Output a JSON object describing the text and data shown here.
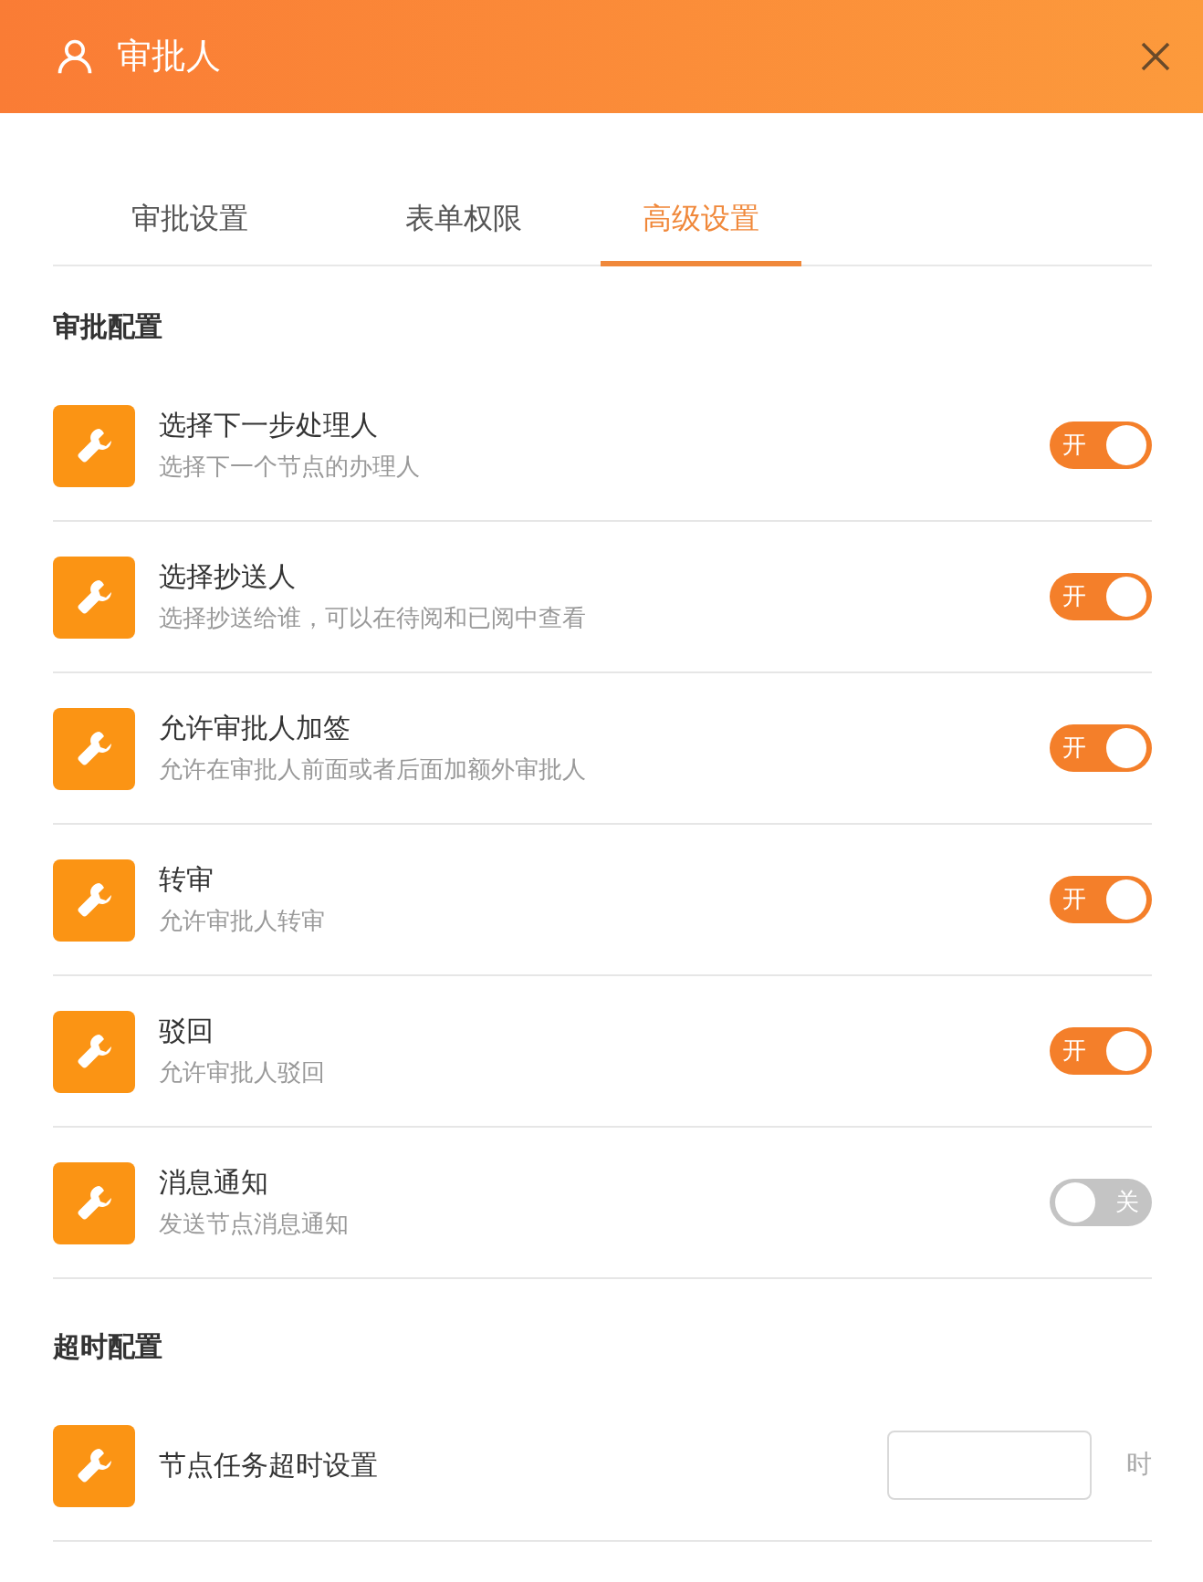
{
  "window": {
    "title": "审批人"
  },
  "tabs": [
    {
      "label": "审批设置",
      "selected": false
    },
    {
      "label": "表单权限",
      "selected": false
    },
    {
      "label": "高级设置",
      "selected": true
    }
  ],
  "sections": [
    {
      "title": "审批配置",
      "rows": [
        {
          "kind": "switch",
          "title": "选择下一步处理人",
          "description": "选择下一个节点的办理人",
          "on": true,
          "switch_label": "开"
        },
        {
          "kind": "switch",
          "title": "选择抄送人",
          "description": "选择抄送给谁，可以在待阅和已阅中查看",
          "on": true,
          "switch_label": "开"
        },
        {
          "kind": "switch",
          "title": "允许审批人加签",
          "description": "允许在审批人前面或者后面加额外审批人",
          "on": true,
          "switch_label": "开"
        },
        {
          "kind": "switch",
          "title": "转审",
          "description": "允许审批人转审",
          "on": true,
          "switch_label": "开"
        },
        {
          "kind": "switch",
          "title": "驳回",
          "description": "允许审批人驳回",
          "on": true,
          "switch_label": "开"
        },
        {
          "kind": "switch",
          "title": "消息通知",
          "description": "发送节点消息通知",
          "on": false,
          "switch_label": "关"
        }
      ]
    },
    {
      "title": "超时配置",
      "rows": [
        {
          "kind": "input",
          "title": "节点任务超时设置",
          "unit": "时"
        }
      ]
    }
  ]
}
